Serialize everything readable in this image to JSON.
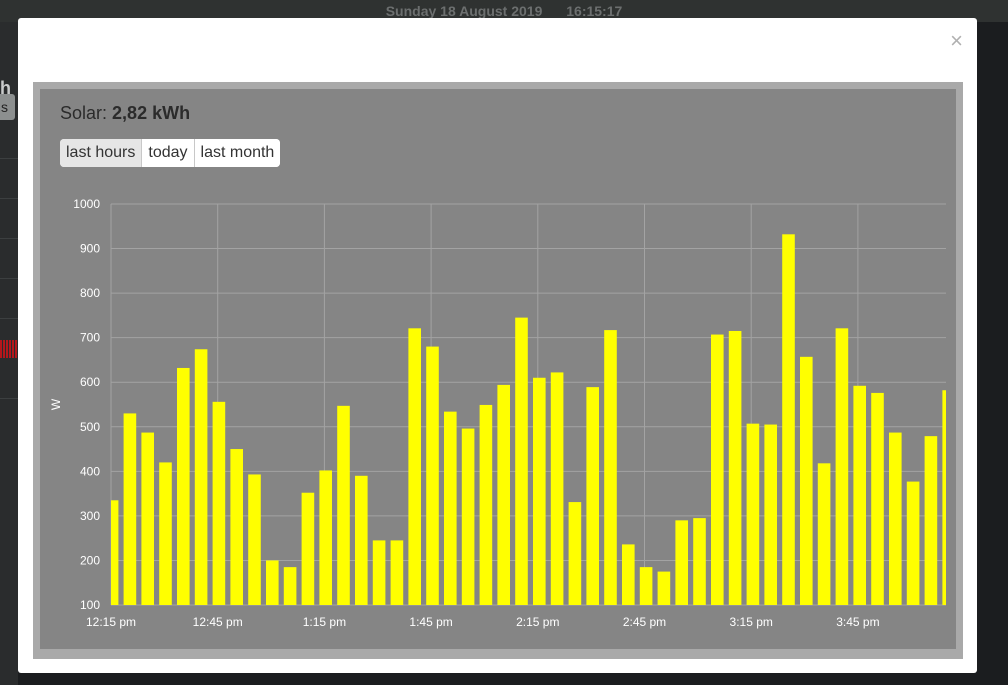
{
  "background": {
    "date": "Sunday 18 August 2019",
    "time": "16:15:17",
    "frag_heading": "h",
    "frag_button": "s"
  },
  "modal": {
    "close_label": "×",
    "title_prefix": "Solar:",
    "title_value": "2,82 kWh",
    "buttons": [
      "last hours",
      "today",
      "last month"
    ],
    "active_button": "last hours"
  },
  "chart_data": {
    "type": "bar",
    "ylabel": "W",
    "ylim": [
      100,
      1000
    ],
    "yticks": [
      100,
      200,
      300,
      400,
      500,
      600,
      700,
      800,
      900,
      1000
    ],
    "xticks": [
      "12:15 pm",
      "12:45 pm",
      "1:15 pm",
      "1:45 pm",
      "2:15 pm",
      "2:45 pm",
      "3:15 pm",
      "3:45 pm"
    ],
    "bar_color": "#ffff00",
    "grid": true,
    "values": [
      335,
      530,
      487,
      420,
      632,
      674,
      556,
      450,
      393,
      200,
      185,
      352,
      402,
      547,
      390,
      245,
      245,
      721,
      680,
      534,
      496,
      549,
      594,
      745,
      610,
      622,
      331,
      589,
      717,
      236,
      185,
      175,
      290,
      295,
      707,
      715,
      507,
      505,
      932,
      657,
      418,
      721,
      592,
      576,
      487,
      377,
      479,
      582
    ]
  }
}
